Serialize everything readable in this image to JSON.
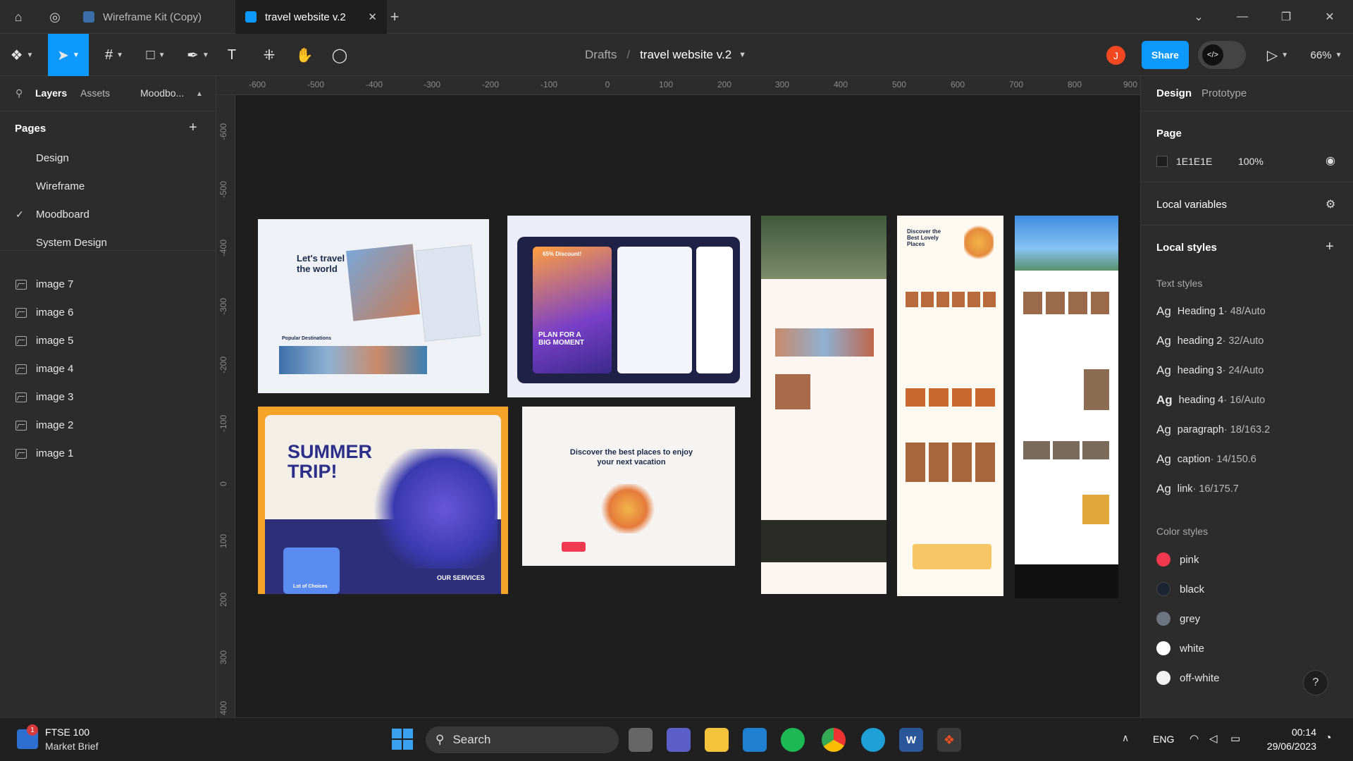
{
  "tabs": [
    {
      "label": "Wireframe Kit (Copy)"
    },
    {
      "label": "travel website v.2"
    }
  ],
  "toolbar": {
    "breadcrumb_root": "Drafts",
    "breadcrumb_sep": "/",
    "file_name": "travel website v.2",
    "avatar_initial": "J",
    "share_label": "Share",
    "zoom": "66%"
  },
  "left_panel": {
    "tabs": [
      "Layers",
      "Assets",
      "Moodbo..."
    ],
    "pages_heading": "Pages",
    "pages": [
      "Design",
      "Wireframe",
      "Moodboard",
      "System Design"
    ],
    "current_page": "Moodboard",
    "layers": [
      "image 7",
      "image 6",
      "image 5",
      "image 4",
      "image 3",
      "image 2",
      "image 1"
    ]
  },
  "rulers": {
    "top": [
      "-600",
      "-500",
      "-400",
      "-300",
      "-200",
      "-100",
      "0",
      "100",
      "200",
      "300",
      "400",
      "500",
      "600",
      "700",
      "800",
      "900"
    ],
    "left": [
      "-600",
      "-500",
      "-400",
      "-300",
      "-200",
      "-100",
      "0",
      "100",
      "200",
      "300",
      "400"
    ]
  },
  "canvas_text": {
    "t1": "Let's travel the world",
    "t1b": "Popular Destinations",
    "t2": "PLAN FOR A BIG MOMENT",
    "t2b": "65% Discount!",
    "t3": "SUMMER TRIP!",
    "t3b": "OUR SERVICES",
    "t3c": "Lot of Choices",
    "t4": "Discover the best places to enjoy your next vacation",
    "t6": "Discover the Best Lovely Places"
  },
  "right_panel": {
    "tabs": [
      "Design",
      "Prototype"
    ],
    "page_heading": "Page",
    "page_color": "1E1E1E",
    "page_opacity": "100%",
    "local_variables": "Local variables",
    "local_styles": "Local styles",
    "text_styles_heading": "Text styles",
    "text_styles": [
      {
        "name": "Heading 1",
        "meta": "48/Auto",
        "bold": true
      },
      {
        "name": "heading 2",
        "meta": "32/Auto",
        "bold": true
      },
      {
        "name": "heading 3",
        "meta": "24/Auto",
        "bold": true
      },
      {
        "name": "heading 4",
        "meta": "16/Auto",
        "bold": true
      },
      {
        "name": "paragraph",
        "meta": "18/163.2",
        "bold": false
      },
      {
        "name": "caption",
        "meta": "14/150.6",
        "bold": false
      },
      {
        "name": "link",
        "meta": "16/175.7",
        "bold": false
      }
    ],
    "color_styles_heading": "Color styles",
    "color_styles": [
      {
        "name": "pink",
        "color": "#f0384e"
      },
      {
        "name": "black",
        "color": "#1a2433"
      },
      {
        "name": "grey",
        "color": "#6b7480"
      },
      {
        "name": "white",
        "color": "#ffffff"
      },
      {
        "name": "off-white",
        "color": "#f1f1f1"
      }
    ],
    "help": "?"
  },
  "taskbar": {
    "widget_title": "FTSE 100",
    "widget_sub": "Market Brief",
    "widget_badge": "1",
    "search": "Search",
    "lang": "ENG",
    "time": "00:14",
    "date": "29/06/2023"
  }
}
